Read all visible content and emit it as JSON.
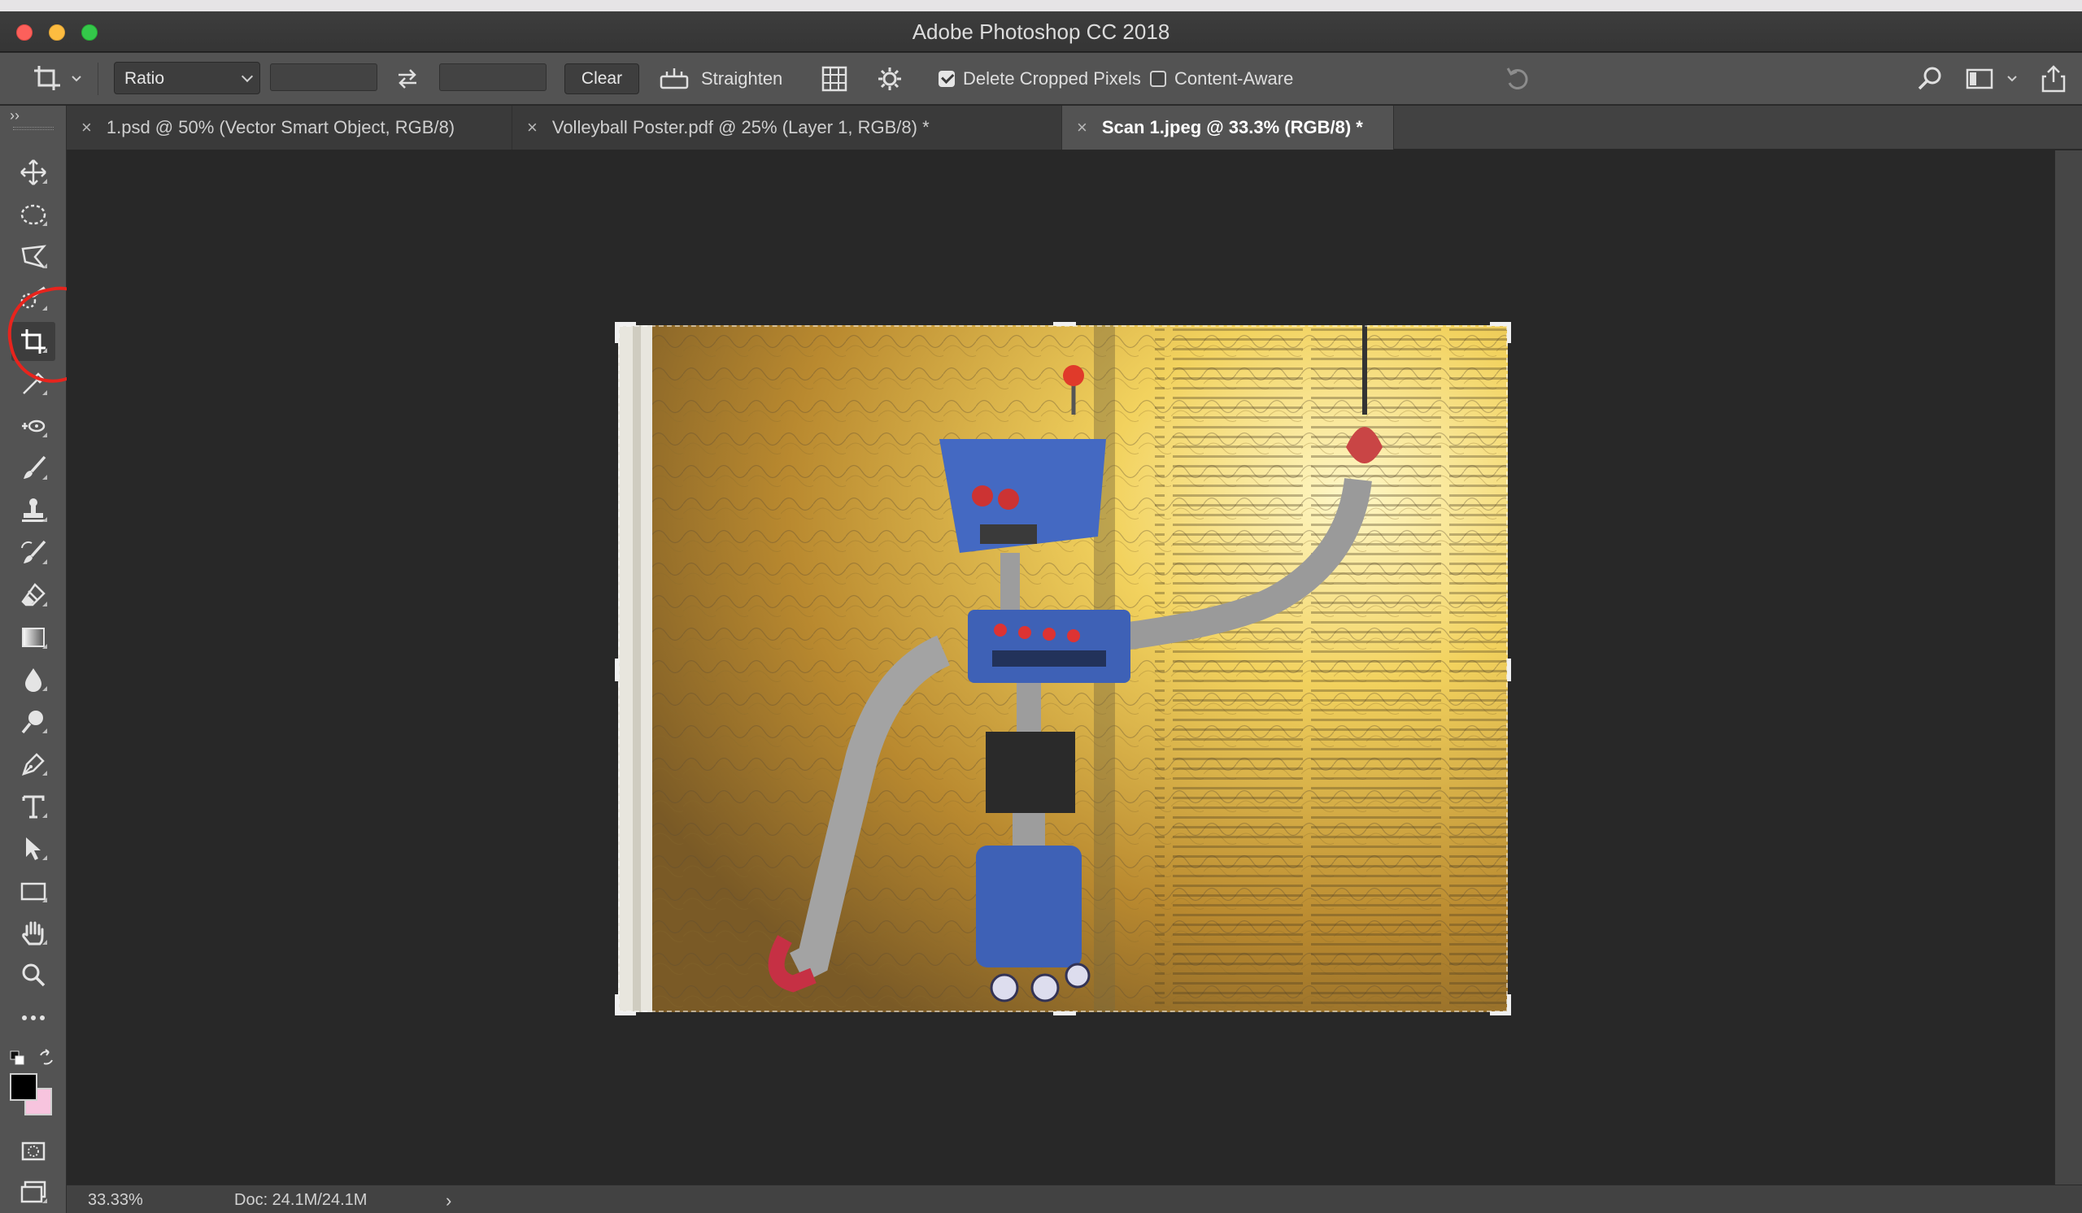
{
  "window": {
    "title": "Adobe Photoshop CC 2018"
  },
  "options_bar": {
    "ratio_label": "Ratio",
    "clear_label": "Clear",
    "straighten_label": "Straighten",
    "delete_cropped_label": "Delete Cropped Pixels",
    "delete_cropped_checked": true,
    "content_aware_label": "Content-Aware",
    "content_aware_checked": false
  },
  "tabs": [
    {
      "label": "1.psd @ 50% (Vector Smart Object, RGB/8)",
      "active": false
    },
    {
      "label": "Volleyball Poster.pdf @ 25% (Layer 1, RGB/8) *",
      "active": false
    },
    {
      "label": "Scan 1.jpeg @ 33.3% (RGB/8) *",
      "active": true
    }
  ],
  "tools": [
    "move-tool-icon",
    "elliptical-marquee-icon",
    "polygonal-lasso-icon",
    "quick-selection-icon",
    "crop-tool-icon",
    "eyedropper-icon",
    "spot-healing-icon",
    "brush-icon",
    "clone-stamp-icon",
    "history-brush-icon",
    "eraser-icon",
    "gradient-icon",
    "blur-icon",
    "dodge-icon",
    "pen-icon",
    "type-icon",
    "path-selection-icon",
    "rectangle-icon",
    "hand-icon",
    "zoom-icon",
    "more-tools-icon"
  ],
  "colors": {
    "foreground": "#000000",
    "background": "#f7c4de",
    "annotation": "#e8241d"
  },
  "status": {
    "zoom": "33.33%",
    "doc": "Doc: 24.1M/24.1M",
    "arrow": "›"
  }
}
